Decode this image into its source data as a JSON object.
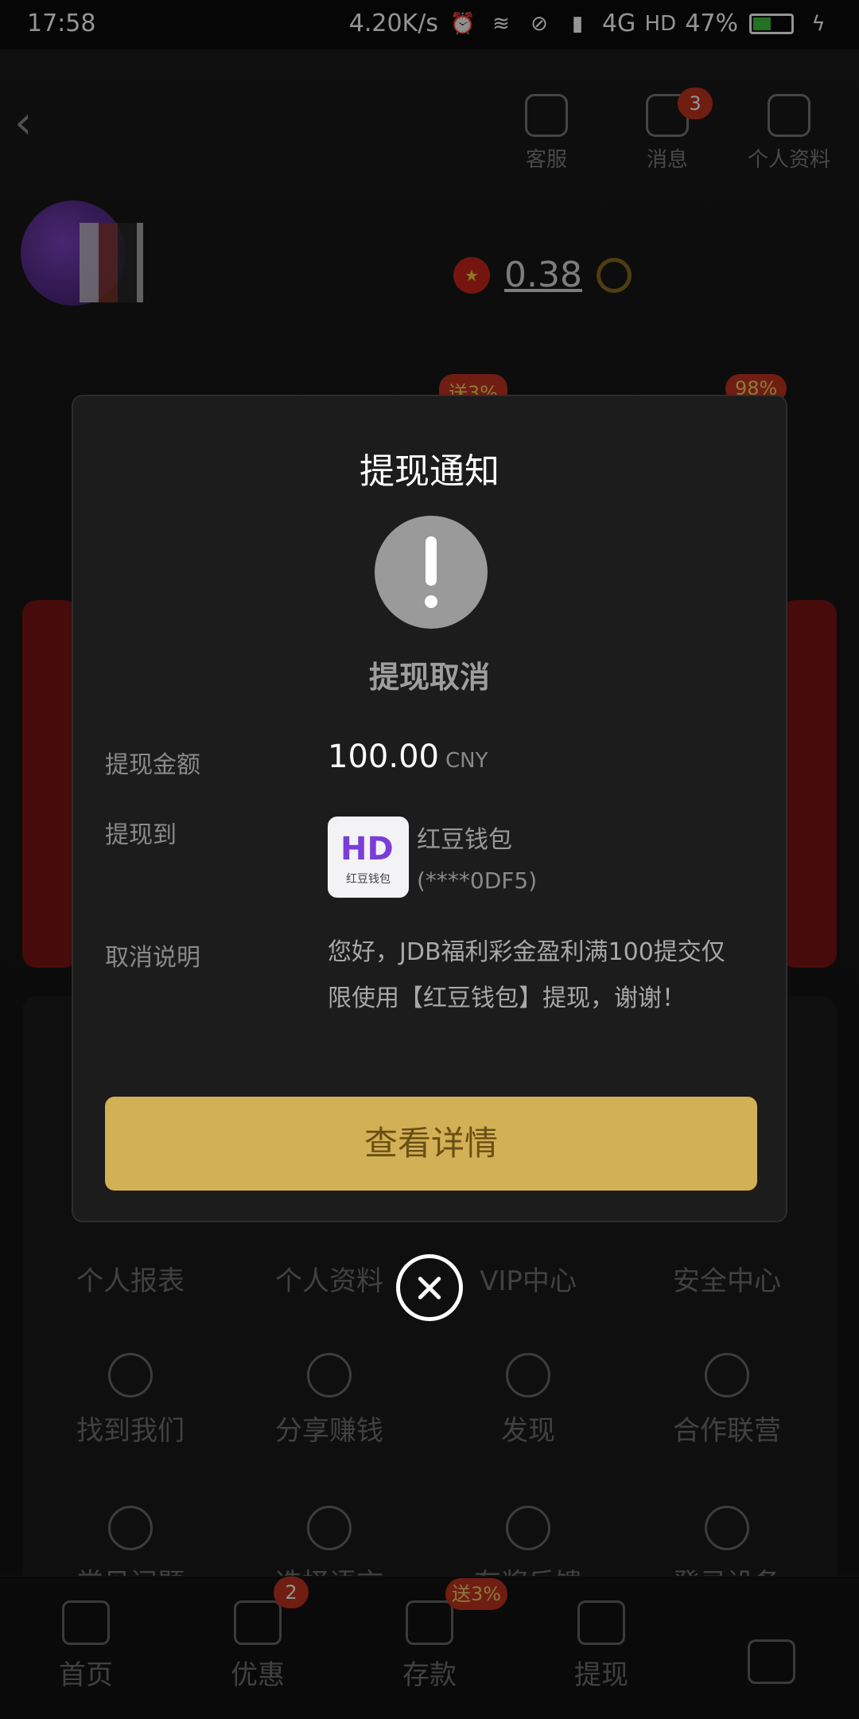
{
  "statusbar": {
    "time": "17:58",
    "speed": "4.20K/s",
    "network": "4G",
    "battery": "47%",
    "icons": [
      "alarm-icon",
      "wifi-icon",
      "dnd-icon",
      "signal-icon",
      "hd-icon",
      "battery-icon",
      "charging-icon"
    ]
  },
  "header": {
    "nav": [
      {
        "label": "客服",
        "icon": "headset-icon"
      },
      {
        "label": "消息",
        "icon": "mail-icon",
        "badge": "3"
      },
      {
        "label": "个人资料",
        "icon": "profile-card-icon"
      }
    ],
    "balance": "0.38",
    "flag": "cn-flag"
  },
  "promo_badges": [
    "送3%",
    "98%"
  ],
  "dialog": {
    "title": "提现通知",
    "status": "提现取消",
    "amount_label": "提现金额",
    "amount": "100.00",
    "currency": "CNY",
    "to_label": "提现到",
    "wallet_logo_text": "HD",
    "wallet_logo_sub": "红豆钱包",
    "wallet_name": "红豆钱包",
    "wallet_account": "(****0DF5)",
    "cancel_label": "取消说明",
    "cancel_note": "您好，JDB福利彩金盈利满100提交仅限使用【红豆钱包】提现，谢谢！",
    "button": "查看详情"
  },
  "menu": {
    "row1": [
      "个人报表",
      "个人资料",
      "VIP中心",
      "安全中心"
    ],
    "row2": [
      "找到我们",
      "分享赚钱",
      "发现",
      "合作联营"
    ],
    "row3": [
      "常见问题",
      "选择语言",
      "有奖反馈",
      "登录设备"
    ]
  },
  "bottomnav": {
    "items": [
      {
        "label": "首页",
        "icon": "home-icon"
      },
      {
        "label": "优惠",
        "icon": "gift-icon",
        "badge": "2"
      },
      {
        "label": "存款",
        "icon": "wallet-icon",
        "badge": "送3%"
      },
      {
        "label": "提现",
        "icon": "cash-icon"
      },
      {
        "label": "",
        "icon": "user-icon"
      }
    ]
  }
}
